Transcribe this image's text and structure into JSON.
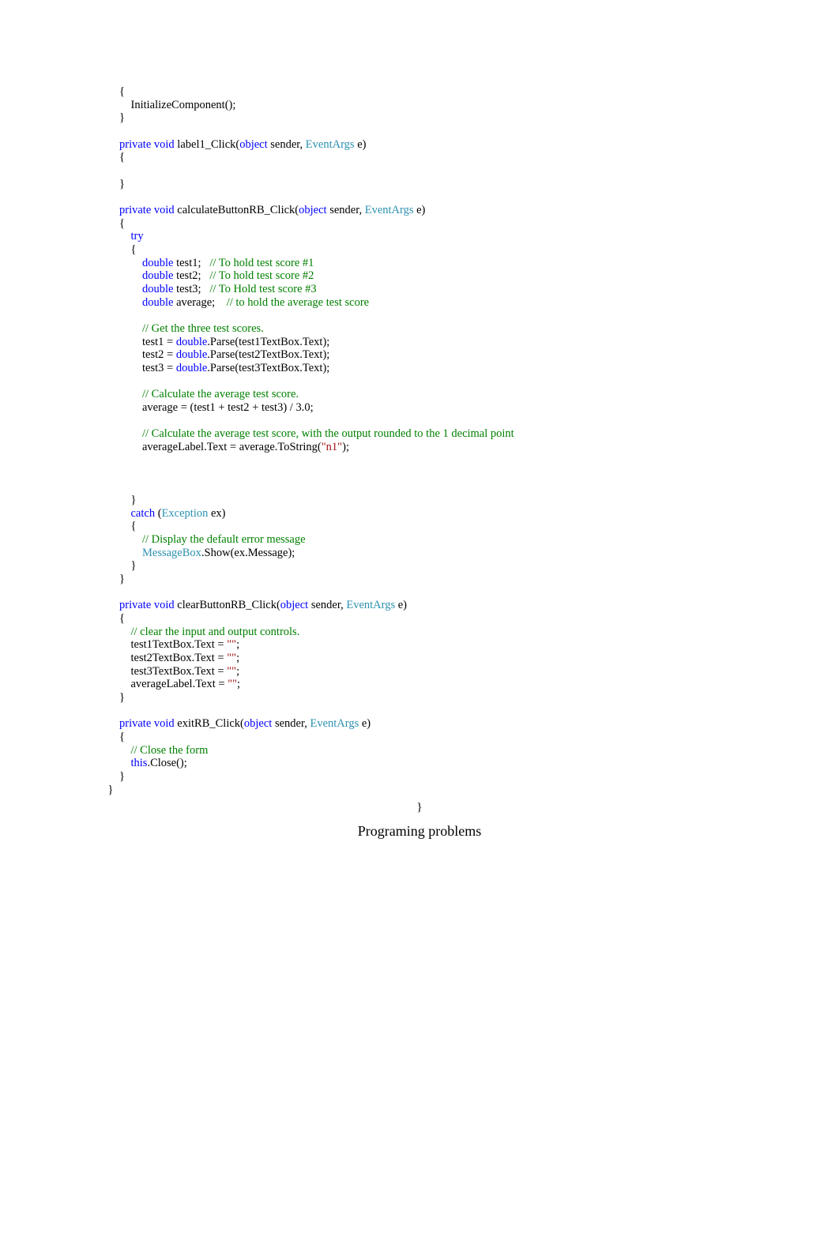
{
  "code": {
    "l1": "        {",
    "l2": "            InitializeComponent();",
    "l3": "        }",
    "l4": "",
    "l5a": "        ",
    "l5b": "private",
    "l5c": " ",
    "l5d": "void",
    "l5e": " label1_Click(",
    "l5f": "object",
    "l5g": " sender, ",
    "l5h": "EventArgs",
    "l5i": " e)",
    "l6": "        {",
    "l7": "",
    "l8": "        }",
    "l9": "",
    "l10a": "        ",
    "l10b": "private",
    "l10c": " ",
    "l10d": "void",
    "l10e": " calculateButtonRB_Click(",
    "l10f": "object",
    "l10g": " sender, ",
    "l10h": "EventArgs",
    "l10i": " e)",
    "l11": "        {",
    "l12a": "            ",
    "l12b": "try",
    "l13": "            {",
    "l14a": "                ",
    "l14b": "double",
    "l14c": " test1;   ",
    "l14d": "// To hold test score #1",
    "l15a": "                ",
    "l15b": "double",
    "l15c": " test2;   ",
    "l15d": "// To hold test score #2",
    "l16a": "                ",
    "l16b": "double",
    "l16c": " test3;   ",
    "l16d": "// To Hold test score #3",
    "l17a": "                ",
    "l17b": "double",
    "l17c": " average;    ",
    "l17d": "// to hold the average test score",
    "l18": "",
    "l19a": "                ",
    "l19b": "// Get the three test scores.",
    "l20a": "                test1 = ",
    "l20b": "double",
    "l20c": ".Parse(test1TextBox.Text);",
    "l21a": "                test2 = ",
    "l21b": "double",
    "l21c": ".Parse(test2TextBox.Text);",
    "l22a": "                test3 = ",
    "l22b": "double",
    "l22c": ".Parse(test3TextBox.Text);",
    "l23": "",
    "l24a": "                ",
    "l24b": "// Calculate the average test score.",
    "l25": "                average = (test1 + test2 + test3) / 3.0;",
    "l26": "",
    "l27a": "                ",
    "l27b": "// Calculate the average test score, with the output rounded to the 1 decimal point",
    "l28a": "                averageLabel.Text = average.ToString(",
    "l28b": "\"n1\"",
    "l28c": ");",
    "l29": "",
    "l30": "",
    "l31": "",
    "l32": "            }",
    "l33a": "            ",
    "l33b": "catch",
    "l33c": " (",
    "l33d": "Exception",
    "l33e": " ex)",
    "l34": "            {",
    "l35a": "                ",
    "l35b": "// Display the default error message",
    "l36a": "                ",
    "l36b": "MessageBox",
    "l36c": ".Show(ex.Message);",
    "l37": "            }",
    "l38": "        }",
    "l39": "",
    "l40a": "        ",
    "l40b": "private",
    "l40c": " ",
    "l40d": "void",
    "l40e": " clearButtonRB_Click(",
    "l40f": "object",
    "l40g": " sender, ",
    "l40h": "EventArgs",
    "l40i": " e)",
    "l41": "        {",
    "l42a": "            ",
    "l42b": "// clear the input and output controls.",
    "l43a": "            test1TextBox.Text = ",
    "l43b": "\"\"",
    "l43c": ";",
    "l44a": "            test2TextBox.Text = ",
    "l44b": "\"\"",
    "l44c": ";",
    "l45a": "            test3TextBox.Text = ",
    "l45b": "\"\"",
    "l45c": ";",
    "l46a": "            averageLabel.Text = ",
    "l46b": "\"\"",
    "l46c": ";",
    "l47": "        }",
    "l48": "",
    "l49a": "        ",
    "l49b": "private",
    "l49c": " ",
    "l49d": "void",
    "l49e": " exitRB_Click(",
    "l49f": "object",
    "l49g": " sender, ",
    "l49h": "EventArgs",
    "l49i": " e)",
    "l50": "        {",
    "l51a": "            ",
    "l51b": "// Close the form",
    "l52a": "            ",
    "l52b": "this",
    "l52c": ".Close();",
    "l53": "        }",
    "l54": "    }"
  },
  "closing_brace": "}",
  "title": "Programing problems"
}
